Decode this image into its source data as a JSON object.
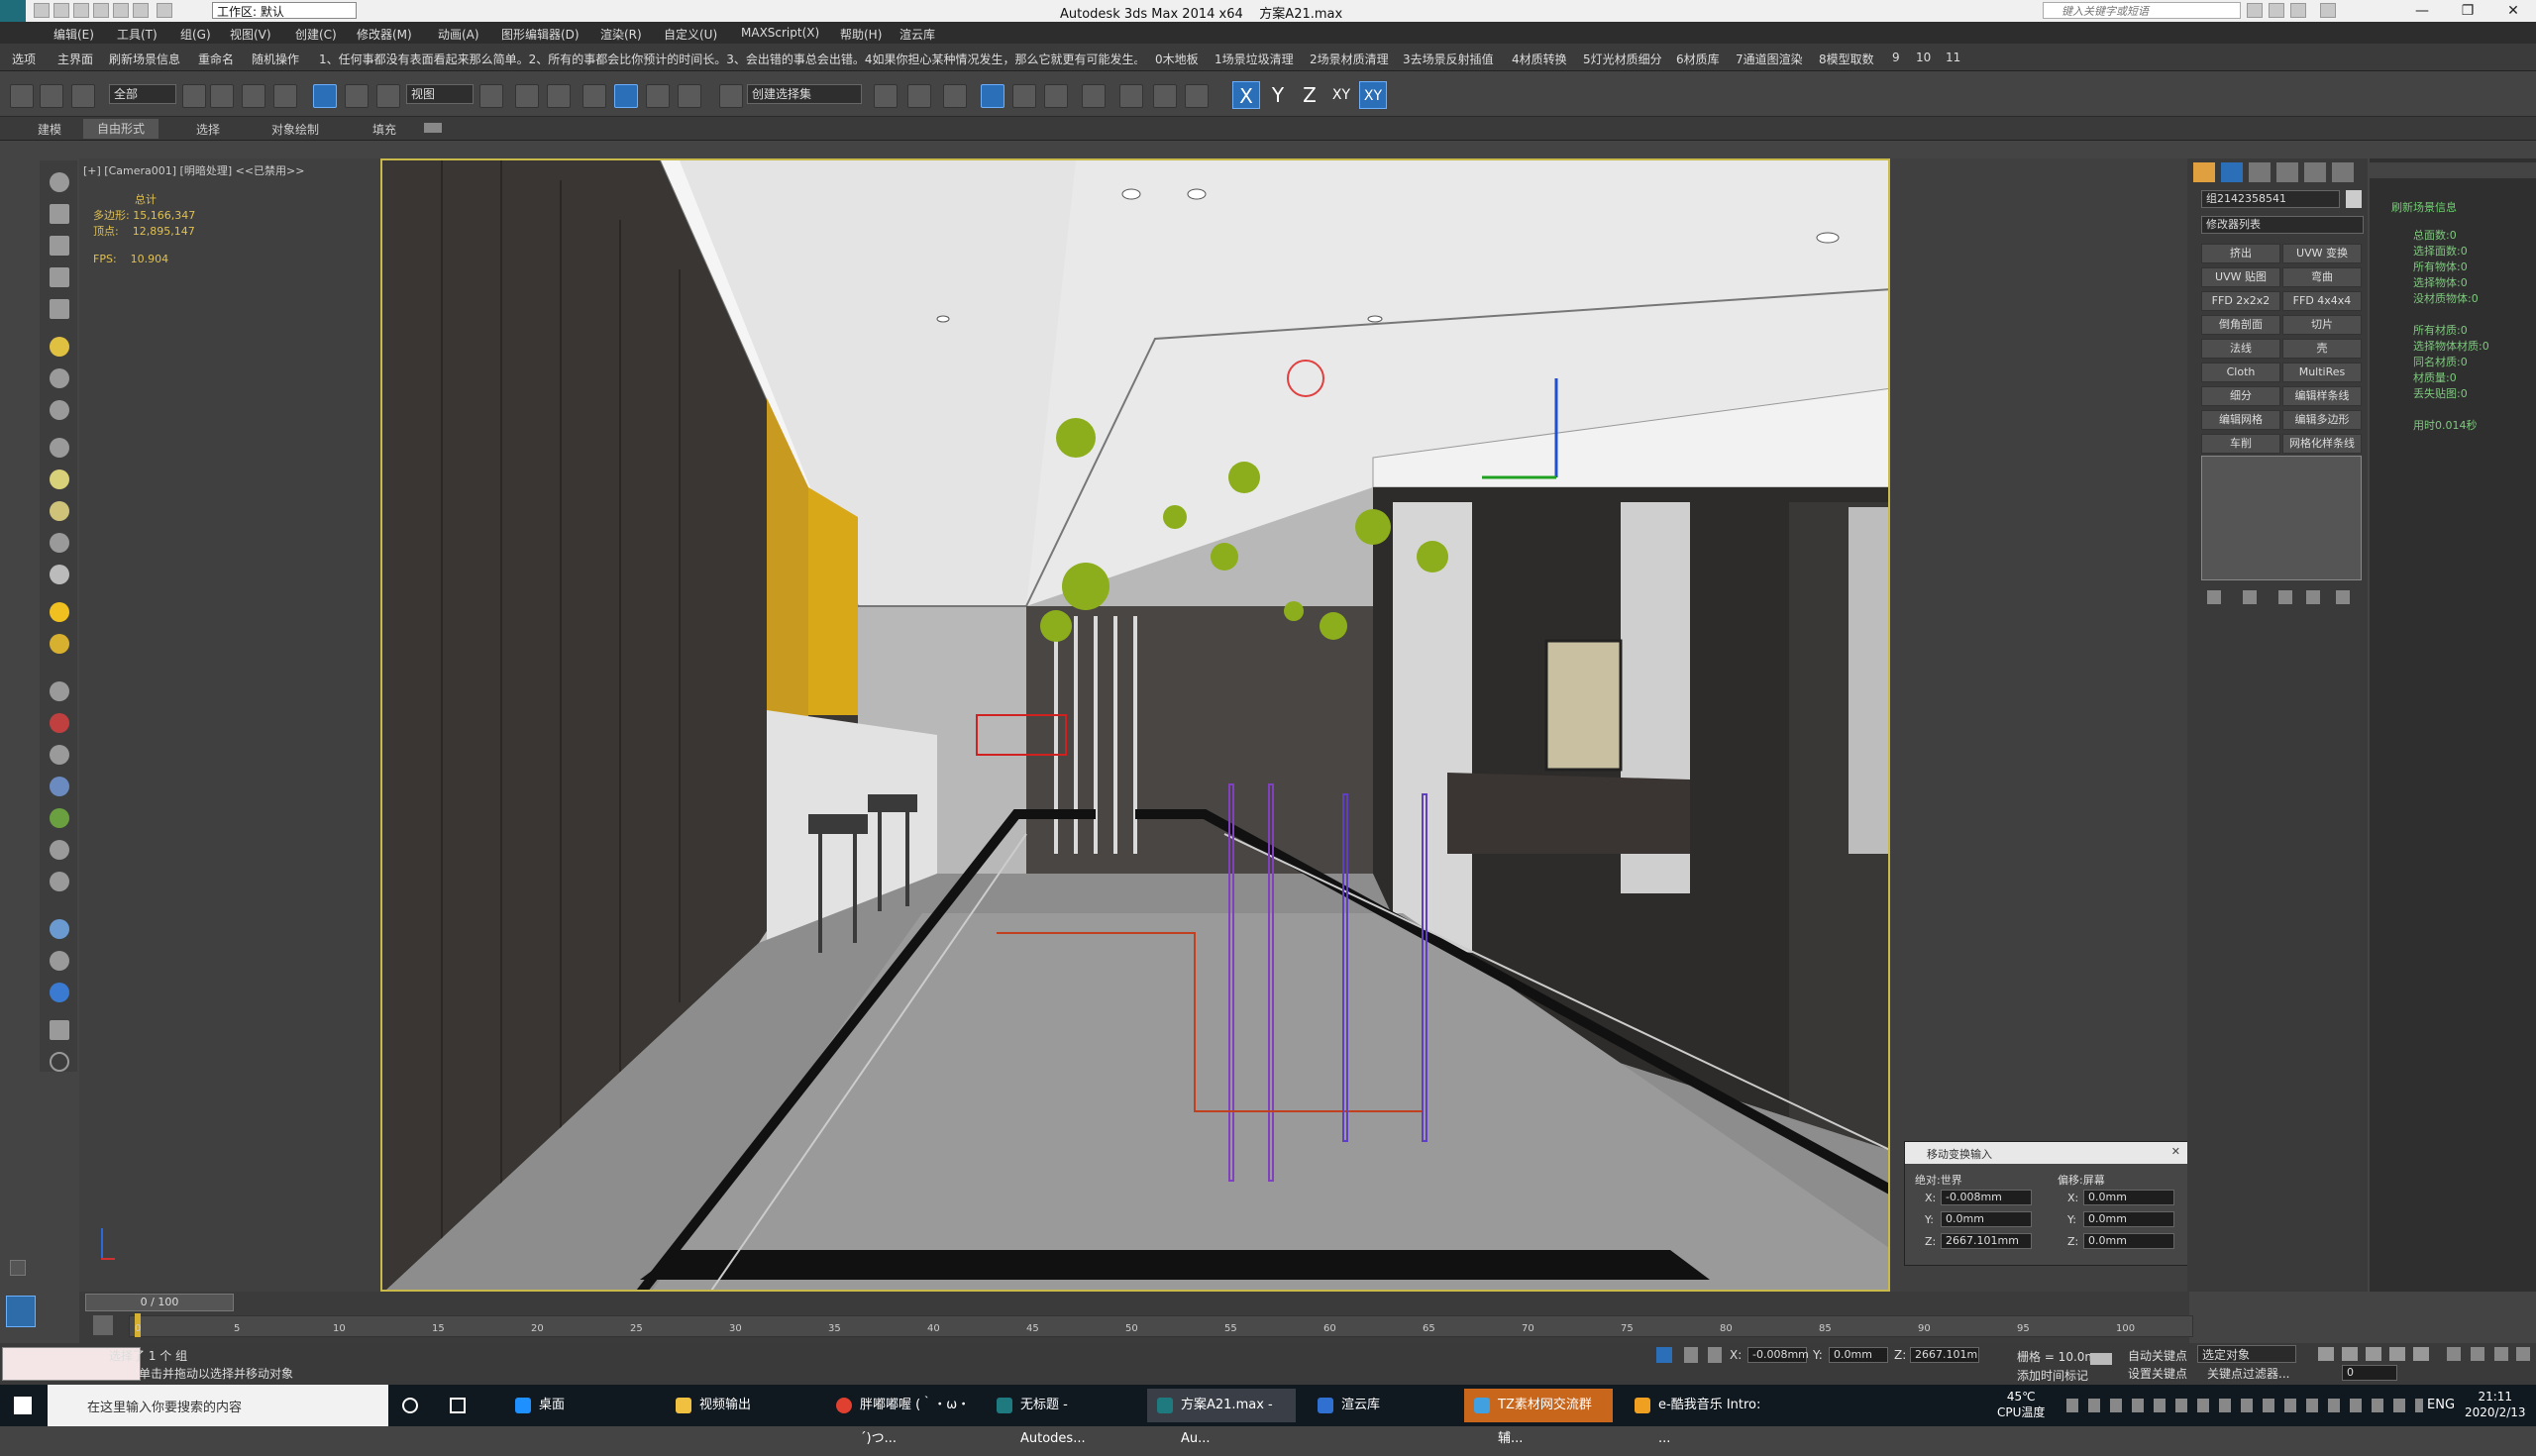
{
  "app": {
    "title": "Autodesk 3ds Max  2014 x64",
    "file": "方案A21.max",
    "workspace": "工作区: 默认",
    "search_placeholder": "键入关键字或短语"
  },
  "menu": [
    "编辑(E)",
    "工具(T)",
    "组(G)",
    "视图(V)",
    "创建(C)",
    "修改器(M)",
    "动画(A)",
    "图形编辑器(D)",
    "渲染(R)",
    "自定义(U)",
    "MAXScript(X)",
    "帮助(H)",
    "渲云库"
  ],
  "scriptbar": [
    "选项",
    "主界面",
    "刷新场景信息",
    "重命名",
    "随机操作",
    "1、任何事都没有表面看起来那么简单。2、所有的事都会比你预计的时间长。3、会出错的事总会出错。4如果你担心某种情况发生，那么它就更有可能发生。",
    "0木地板",
    "1场景垃圾清理",
    "2场景材质清理",
    "3去场景反射插值",
    "4材质转换",
    "5灯光材质细分",
    "6材质库",
    "7通道图渲染",
    "8模型取数",
    "9",
    "10",
    "11"
  ],
  "toolbar": {
    "selection_filter": "全部",
    "ref_coord": "视图",
    "named_sel": "创建选择集",
    "axes": [
      "X",
      "Y",
      "Z",
      "XY",
      "XY"
    ]
  },
  "ribbon": [
    "建模",
    "自由形式",
    "选择",
    "对象绘制",
    "填充"
  ],
  "viewport": {
    "label": "[+] [Camera001] [明暗处理]  <<已禁用>>",
    "stats": {
      "header": "总计",
      "poly_label": "多边形:",
      "poly": "15,166,347",
      "vert_label": "顶点:",
      "vert": "12,895,147",
      "fps_label": "FPS:",
      "fps": "10.904"
    }
  },
  "command_panel": {
    "object_name": "组2142358541",
    "modifier_list": "修改器列表",
    "buttons": [
      "挤出",
      "UVW 变换",
      "UVW 贴图",
      "弯曲",
      "FFD 2x2x2",
      "FFD 4x4x4",
      "倒角剖面",
      "切片",
      "法线",
      "壳",
      "Cloth",
      "MultiRes",
      "细分",
      "编辑样条线",
      "编辑网格",
      "编辑多边形",
      "车削",
      "网格化样条线"
    ]
  },
  "scene_info": {
    "title": "刷新场景信息",
    "lines": [
      "总面数:0",
      "选择面数:0",
      "所有物体:0",
      "选择物体:0",
      "没材质物体:0",
      "",
      "所有材质:0",
      "选择物体材质:0",
      "同名材质:0",
      "材质量:0",
      "丢失贴图:0",
      "",
      "用时0.014秒"
    ]
  },
  "transform_dialog": {
    "title": "移动变换输入",
    "absolute_label": "绝对:世界",
    "offset_label": "偏移:屏幕",
    "abs": {
      "x": "-0.008mm",
      "y": "0.0mm",
      "z": "2667.101mm"
    },
    "off": {
      "x": "0.0mm",
      "y": "0.0mm",
      "z": "0.0mm"
    }
  },
  "timeline": {
    "frame": "0 / 100",
    "ticks": [
      "0",
      "5",
      "10",
      "15",
      "20",
      "25",
      "30",
      "35",
      "40",
      "45",
      "50",
      "55",
      "60",
      "65",
      "70",
      "75",
      "80",
      "85",
      "90",
      "95",
      "100"
    ]
  },
  "status": {
    "selected": "选择了 1 个 组",
    "prompt": "单击并拖动以选择并移动对象",
    "x": "-0.008mm",
    "y": "0.0mm",
    "z": "2667.101m",
    "grid": "栅格 = 10.0mm",
    "autokey": "自动关键点",
    "setkey": "设置关键点",
    "key_mode": "选定对象",
    "key_filter": "关键点过滤器...",
    "add_time_tag": "添加时间标记",
    "frame_num": "0"
  },
  "taskbar": {
    "search": "在这里输入你要搜索的内容",
    "items": [
      "桌面",
      "视频输出",
      "胖嘟嘟喔 (｀・ω・´)つ...",
      "无标题 - Autodes...",
      "方案A21.max - Au...",
      "渲云库",
      "TZ素材网交流群辅...",
      "e-酷我音乐 Intro: ..."
    ],
    "temp": "45℃",
    "temp_label": "CPU温度",
    "lang": "ENG",
    "time": "21:11",
    "date": "2020/2/13"
  },
  "colors": {
    "viewport_border": "#c9b84a",
    "accent": "#2b6fb8",
    "scene_text": "#7ec97e"
  }
}
